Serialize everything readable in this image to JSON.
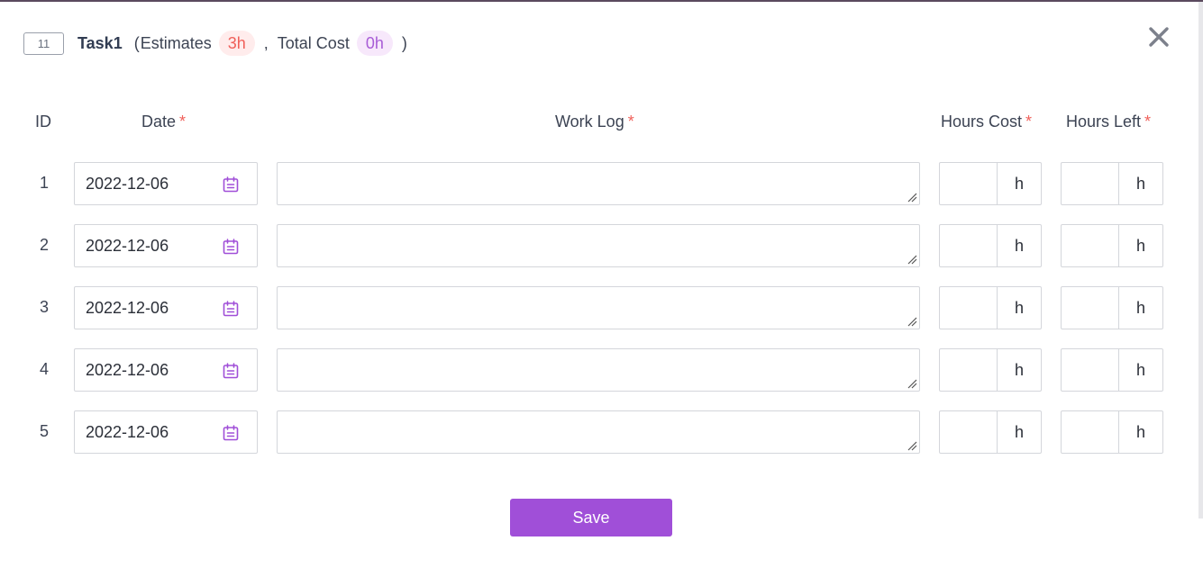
{
  "task": {
    "id_badge": "11",
    "name": "Task1",
    "open_paren": "(",
    "estimates_label": "Estimates",
    "estimates_value": "3h",
    "comma": ",",
    "total_cost_label": "Total Cost",
    "total_cost_value": "0h",
    "close_paren": ")"
  },
  "columns": {
    "id": "ID",
    "date": "Date",
    "work_log": "Work Log",
    "hours_cost": "Hours Cost",
    "hours_left": "Hours Left",
    "required_mark": "*"
  },
  "rows": [
    {
      "id": "1",
      "date": "2022-12-06",
      "work_log": "",
      "hours_cost": "",
      "hours_left": "",
      "unit": "h"
    },
    {
      "id": "2",
      "date": "2022-12-06",
      "work_log": "",
      "hours_cost": "",
      "hours_left": "",
      "unit": "h"
    },
    {
      "id": "3",
      "date": "2022-12-06",
      "work_log": "",
      "hours_cost": "",
      "hours_left": "",
      "unit": "h"
    },
    {
      "id": "4",
      "date": "2022-12-06",
      "work_log": "",
      "hours_cost": "",
      "hours_left": "",
      "unit": "h"
    },
    {
      "id": "5",
      "date": "2022-12-06",
      "work_log": "",
      "hours_cost": "",
      "hours_left": "",
      "unit": "h"
    }
  ],
  "actions": {
    "save_label": "Save"
  },
  "icons": {
    "close": "close-icon",
    "calendar": "calendar-icon"
  },
  "colors": {
    "accent": "#a04fd8",
    "required": "#f0605a",
    "estimate_pill_bg": "#ffecec",
    "cost_pill_bg": "#f7e8fb"
  }
}
